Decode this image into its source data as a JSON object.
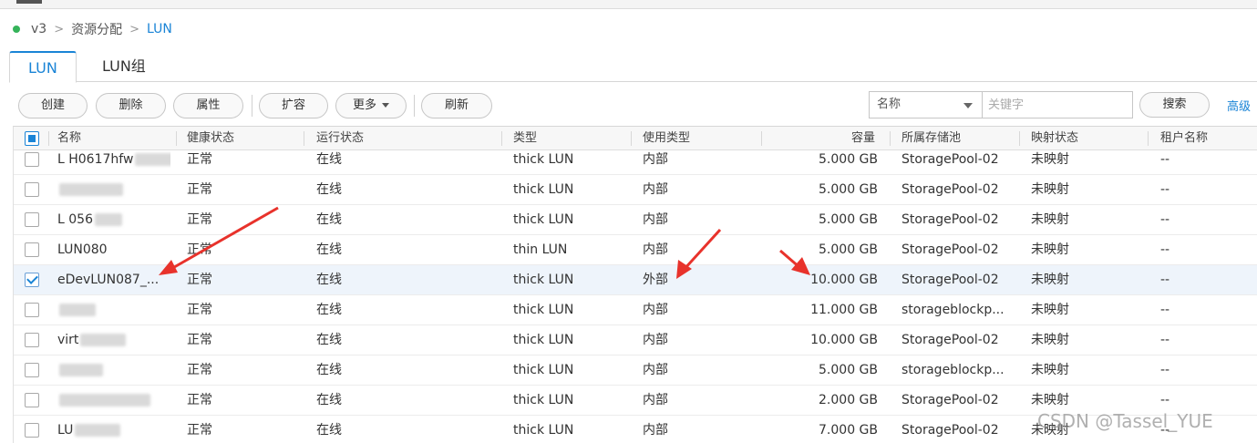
{
  "breadcrumb": {
    "items": [
      "v3",
      "资源分配",
      "LUN"
    ]
  },
  "tabs": [
    "LUN",
    "LUN组"
  ],
  "toolbar": {
    "create": "创建",
    "delete": "删除",
    "properties": "属性",
    "expand": "扩容",
    "more": "更多",
    "refresh": "刷新"
  },
  "search": {
    "field": "名称",
    "placeholder": "关键字",
    "button": "搜索",
    "advanced": "高级"
  },
  "table": {
    "columns": [
      "名称",
      "健康状态",
      "运行状态",
      "类型",
      "使用类型",
      "容量",
      "所属存储池",
      "映射状态",
      "租户名称"
    ],
    "rows": [
      {
        "name": "L  H0617hfw",
        "health": "正常",
        "running": "在线",
        "type": "thick LUN",
        "usage": "内部",
        "capacity": "5.000 GB",
        "pool": "StoragePool-02",
        "mapping": "未映射",
        "tenant": "--",
        "checked": false
      },
      {
        "name": "",
        "health": "正常",
        "running": "在线",
        "type": "thick LUN",
        "usage": "内部",
        "capacity": "5.000 GB",
        "pool": "StoragePool-02",
        "mapping": "未映射",
        "tenant": "--",
        "checked": false
      },
      {
        "name": "L  056",
        "health": "正常",
        "running": "在线",
        "type": "thick LUN",
        "usage": "内部",
        "capacity": "5.000 GB",
        "pool": "StoragePool-02",
        "mapping": "未映射",
        "tenant": "--",
        "checked": false
      },
      {
        "name": "LUN080",
        "health": "正常",
        "running": "在线",
        "type": "thin LUN",
        "usage": "内部",
        "capacity": "5.000 GB",
        "pool": "StoragePool-02",
        "mapping": "未映射",
        "tenant": "--",
        "checked": false
      },
      {
        "name": "eDevLUN087_...",
        "health": "正常",
        "running": "在线",
        "type": "thick LUN",
        "usage": "外部",
        "capacity": "10.000 GB",
        "pool": "StoragePool-02",
        "mapping": "未映射",
        "tenant": "--",
        "checked": true
      },
      {
        "name": "",
        "health": "正常",
        "running": "在线",
        "type": "thick LUN",
        "usage": "内部",
        "capacity": "11.000 GB",
        "pool": "storageblockp...",
        "mapping": "未映射",
        "tenant": "--",
        "checked": false
      },
      {
        "name": "virt",
        "health": "正常",
        "running": "在线",
        "type": "thick LUN",
        "usage": "内部",
        "capacity": "10.000 GB",
        "pool": "StoragePool-02",
        "mapping": "未映射",
        "tenant": "--",
        "checked": false
      },
      {
        "name": "",
        "health": "正常",
        "running": "在线",
        "type": "thick LUN",
        "usage": "内部",
        "capacity": "5.000 GB",
        "pool": "storageblockp...",
        "mapping": "未映射",
        "tenant": "--",
        "checked": false
      },
      {
        "name": "",
        "health": "正常",
        "running": "在线",
        "type": "thick LUN",
        "usage": "内部",
        "capacity": "2.000 GB",
        "pool": "StoragePool-02",
        "mapping": "未映射",
        "tenant": "--",
        "checked": false
      },
      {
        "name": "LU",
        "health": "正常",
        "running": "在线",
        "type": "thick LUN",
        "usage": "内部",
        "capacity": "7.000 GB",
        "pool": "StoragePool-02",
        "mapping": "未映射",
        "tenant": "--",
        "checked": false
      }
    ]
  },
  "annotations": {
    "arrow_color": "#e8322b"
  },
  "watermark": "CSDN @Tassel_YUE"
}
